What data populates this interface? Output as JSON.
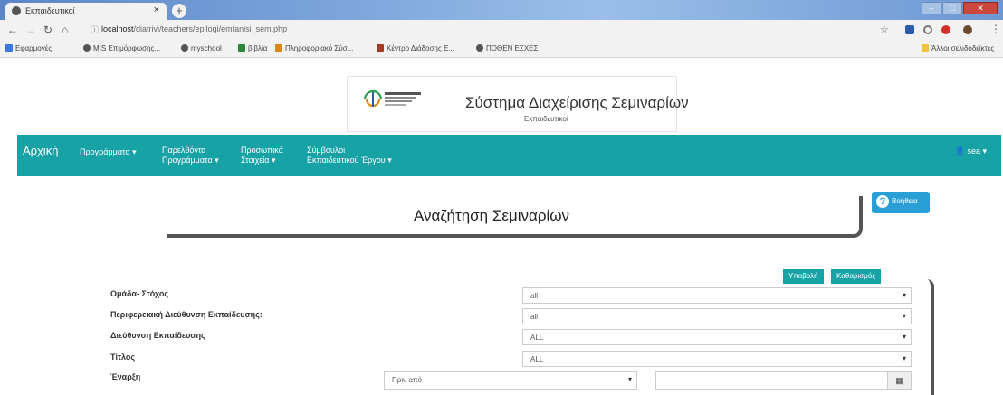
{
  "browser": {
    "tab_title": "Εκπαιδευτικοί",
    "tab_close": "×",
    "new_tab": "+",
    "url_host": "localhost",
    "url_path": "/diatrivi/teachers/epilogi/emfanisi_sem.php",
    "bookmarks": [
      "Εφαρμογές",
      "MIS Επιμόρφωσης...",
      "myschool",
      "βιβλία",
      "Πληροφοριακό Σύσ...",
      "Κέντρο Διάδοσης Ε...",
      "ΠΟΘΕΝ ΕΣΧΕΣ"
    ],
    "other_bookmarks": "Άλλοι σελιδοδείκτες"
  },
  "header": {
    "title": "Σύστημα Διαχείρισης Σεμιναρίων",
    "subtitle": "Εκπαιδευτικοί"
  },
  "nav": {
    "home": "Αρχική",
    "programs": "Προγράμματα ▾",
    "past_line1": "Παρελθόντα",
    "past_line2": "Προγράμματα ▾",
    "personal_line1": "Προσωπικά",
    "personal_line2": "Στοιχεία ▾",
    "advisors_line1": "Σύμβουλοι",
    "advisors_line2": "Εκπαιδευτικού Έργου ▾",
    "user": "sea ▾"
  },
  "help": {
    "label": "Βοήθεια",
    "icon": "?"
  },
  "page": {
    "search_title": "Αναζήτηση Σεμιναρίων"
  },
  "buttons": {
    "submit": "Υποβολή",
    "clear": "Καθαρισμός"
  },
  "form": {
    "target_group_label": "Ομάδα- Στόχος",
    "target_group_value": "all",
    "regional_label": "Περιφερειακή Διεύθυνση Εκπαίδευσης:",
    "regional_value": "all",
    "directorate_label": "Διεύθυνση Εκπαίδευσης",
    "directorate_value": "ALL",
    "title_label": "Τίτλος",
    "title_value": "ALL",
    "start_label": "Έναρξη",
    "start_value": "Πριν από"
  },
  "colors": {
    "navbar": "#17a2a6",
    "help": "#2a9fd6"
  }
}
